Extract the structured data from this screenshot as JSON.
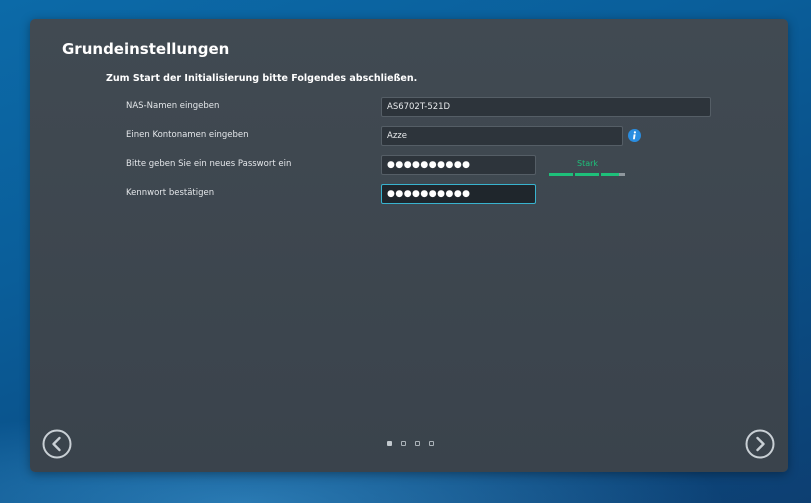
{
  "wizard": {
    "title": "Grundeinstellungen",
    "subtitle": "Zum Start der Initialisierung bitte Folgendes abschließen.",
    "fields": [
      {
        "label": "NAS-Namen eingeben",
        "value": "AS6702T-521D"
      },
      {
        "label": "Einen Kontonamen eingeben",
        "value": "Azze"
      },
      {
        "label": "Bitte geben Sie ein neues Passwort ein",
        "value": "●●●●●●●●●●"
      },
      {
        "label": "Kennwort bestätigen",
        "value": "●●●●●●●●●●"
      }
    ],
    "password_strength": {
      "label": "Stark",
      "level": 0.92,
      "color": "#1ec07a"
    },
    "pager": {
      "total": 4,
      "current": 1
    },
    "colors": {
      "accent": "#38b3cf",
      "panel": "#3d464e",
      "info": "#2a8de0"
    },
    "icons": {
      "info": "info-icon",
      "prev": "chevron-left-circle-icon",
      "next": "chevron-right-circle-icon"
    }
  }
}
